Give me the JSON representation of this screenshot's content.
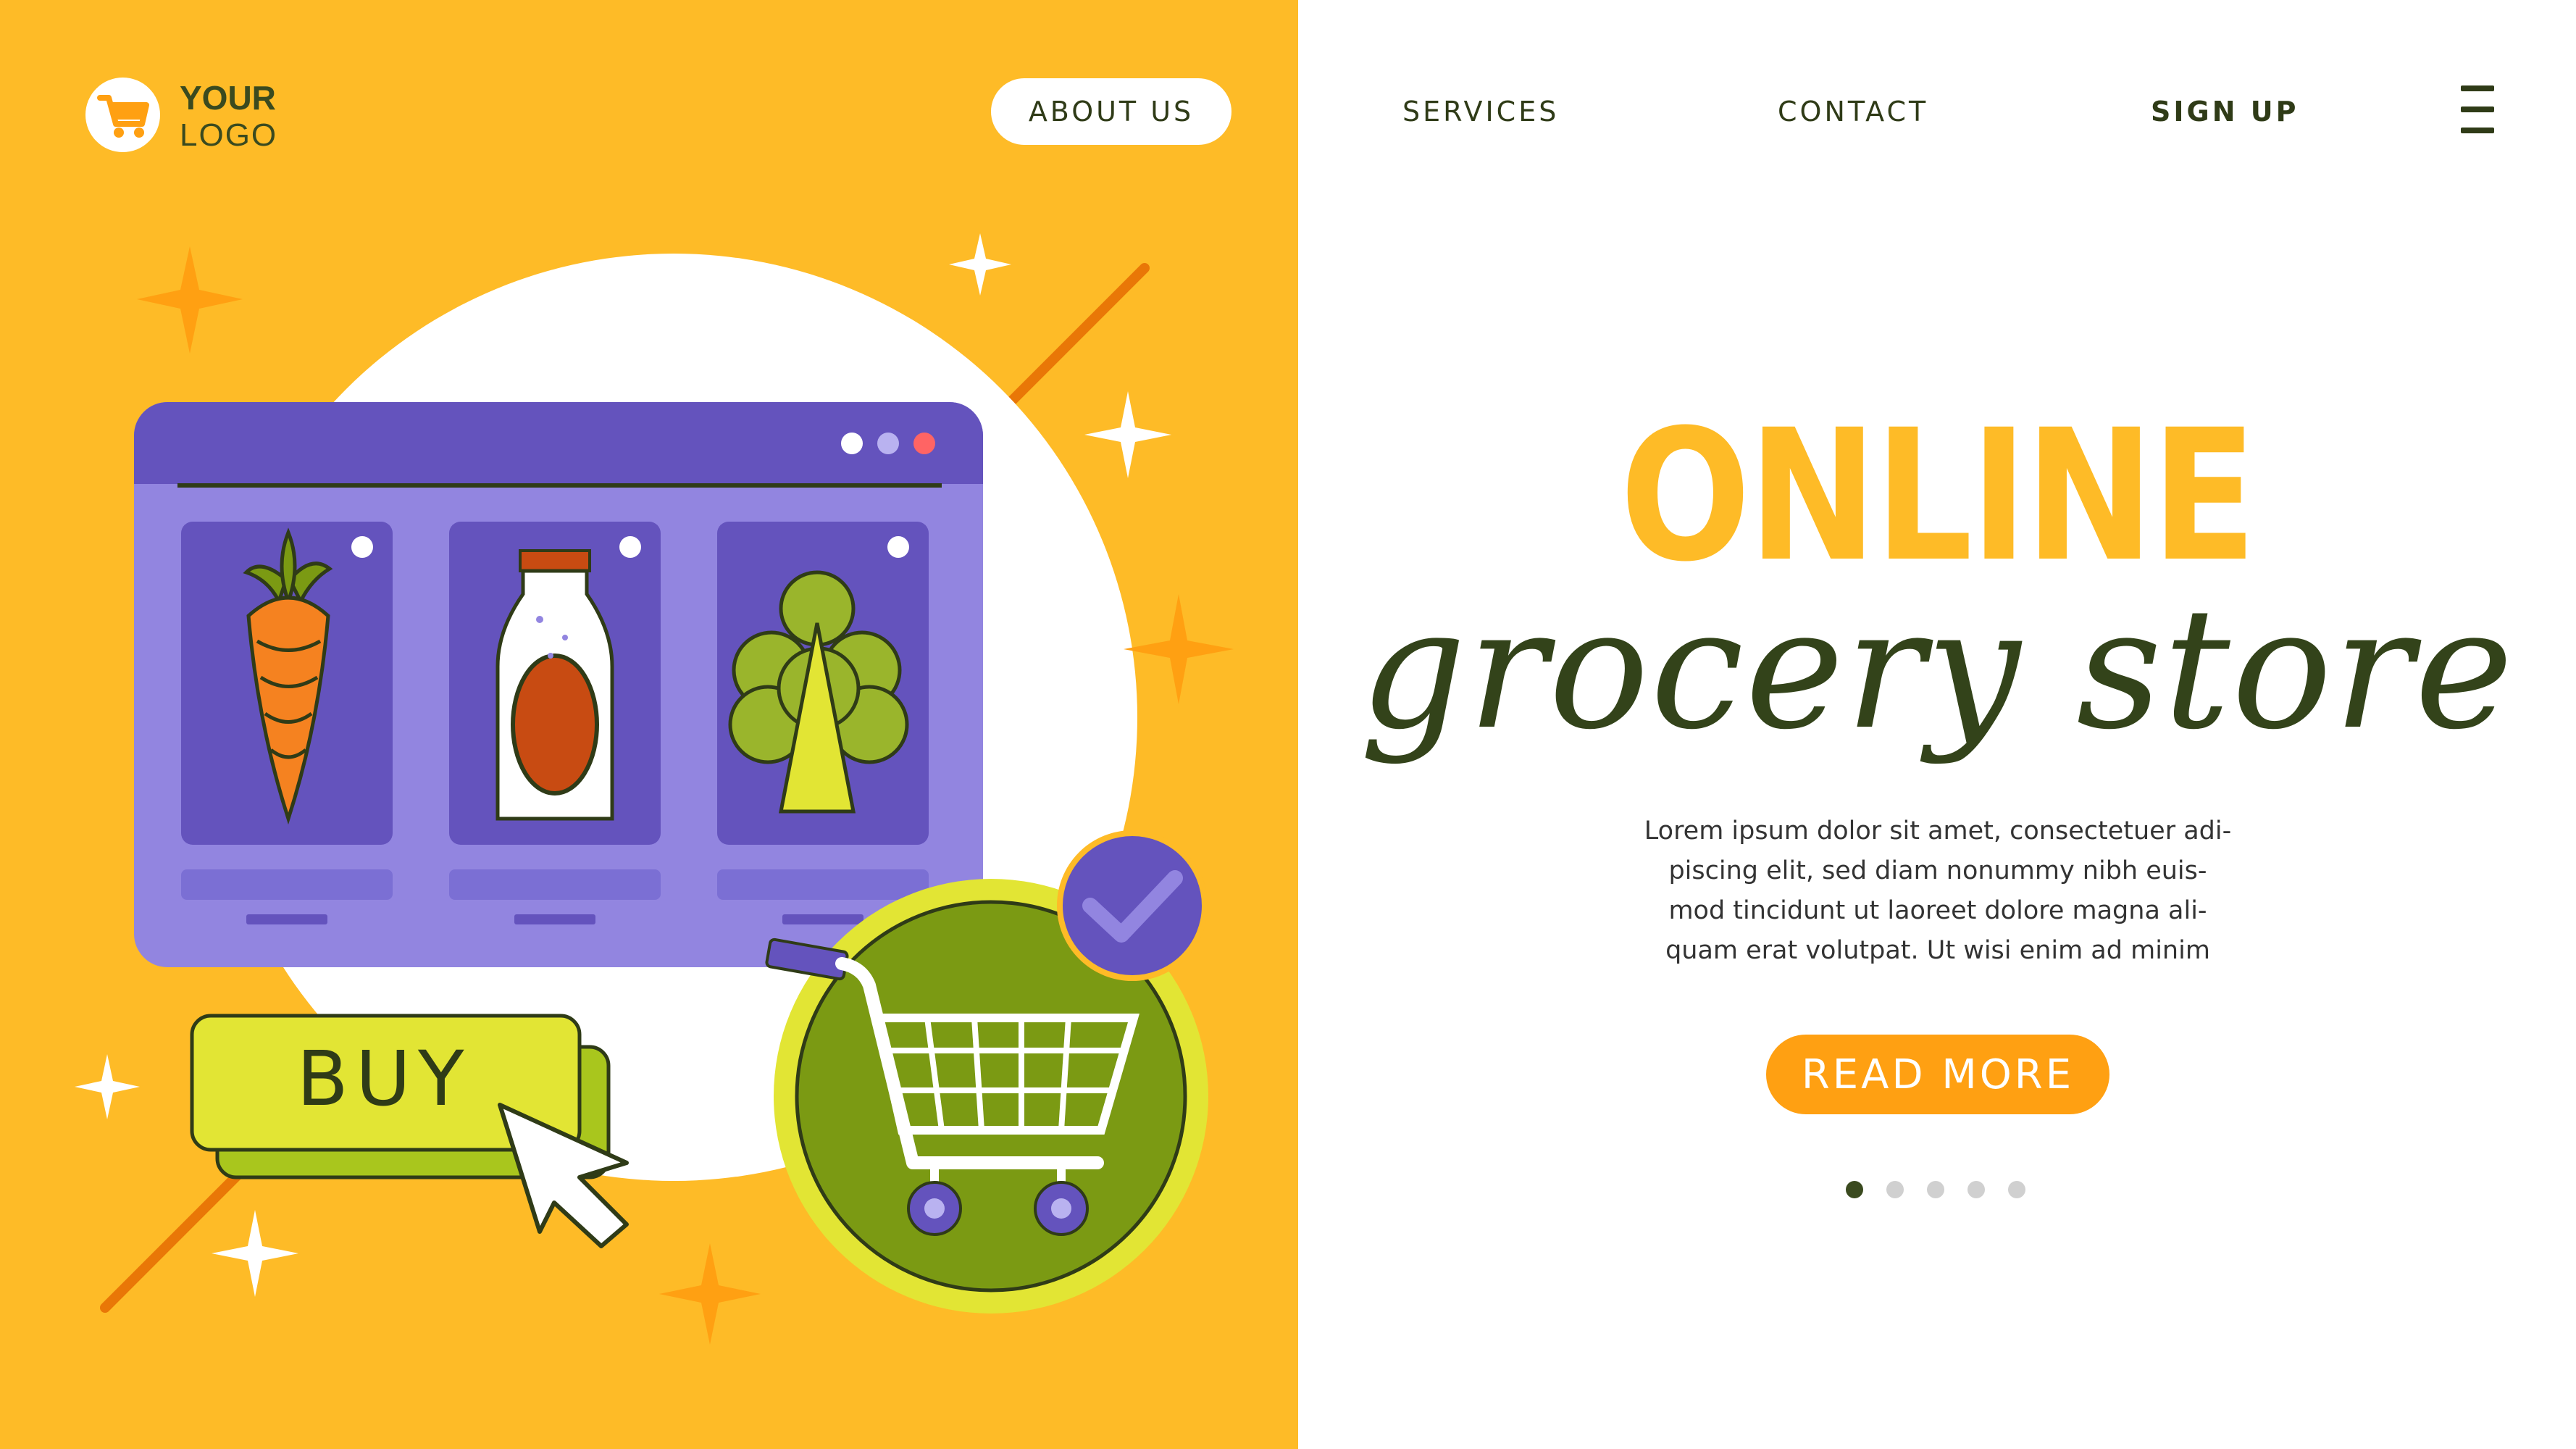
{
  "logo": {
    "line1": "YOUR",
    "line2": "LOGO",
    "icon": "shopping-cart-icon"
  },
  "nav": {
    "about": "ABOUT US",
    "services": "SERVICES",
    "contact": "CONTACT",
    "signup": "SIGN UP",
    "menu_icon": "hamburger-menu-icon"
  },
  "hero": {
    "title": "ONLINE",
    "subtitle": "grocery store",
    "description_lines": [
      "Lorem ipsum dolor sit amet, consectetuer adi-",
      "piscing elit, sed diam nonummy nibh euis-",
      "mod tincidunt ut laoreet dolore magna ali-",
      "quam erat volutpat. Ut wisi enim ad minim"
    ],
    "cta": "READ MORE"
  },
  "illustration": {
    "buy_label": "BUY",
    "products": [
      "carrot-icon",
      "milk-bottle-icon",
      "broccoli-icon"
    ]
  },
  "carousel": {
    "count": 5,
    "active": 0
  },
  "colors": {
    "yellow": "#FEBB27",
    "dark_green": "#33431A",
    "orange": "#FFA012",
    "purple": "#6453BD",
    "lavender": "#9285E0",
    "lime": "#E2E534",
    "olive": "#7B9A13"
  }
}
